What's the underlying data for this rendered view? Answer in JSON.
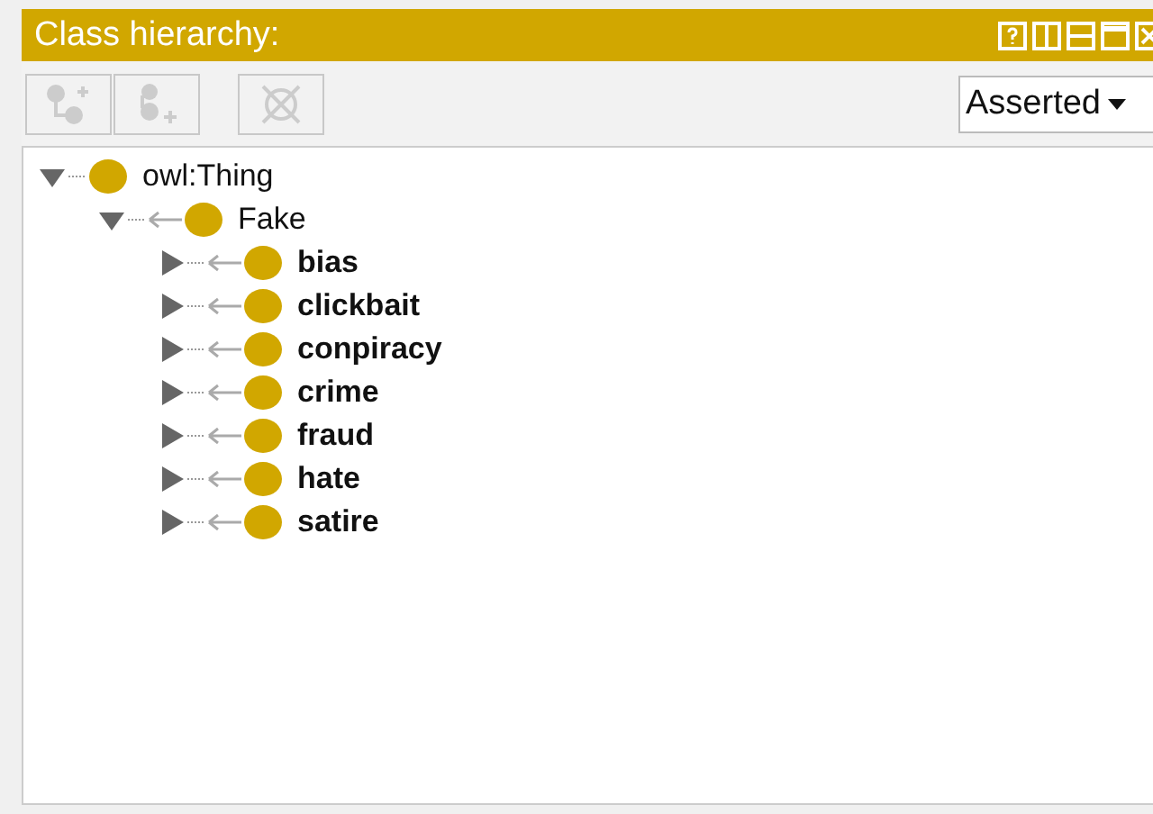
{
  "panel": {
    "title": "Class hierarchy:"
  },
  "toolbar": {
    "buttons": [
      {
        "kind": "add-subclass",
        "disabled": true
      },
      {
        "kind": "add-sibling",
        "disabled": true
      },
      {
        "kind": "delete",
        "disabled": true
      }
    ],
    "view_select": {
      "value": "Asserted"
    }
  },
  "tree": [
    {
      "label": "owl:Thing",
      "expanded": true,
      "bold": false,
      "children": [
        {
          "label": "Fake",
          "expanded": true,
          "bold": false,
          "children": [
            {
              "label": "bias",
              "expanded": false,
              "bold": true
            },
            {
              "label": "clickbait",
              "expanded": false,
              "bold": true
            },
            {
              "label": "conpiracy",
              "expanded": false,
              "bold": true
            },
            {
              "label": "crime",
              "expanded": false,
              "bold": true
            },
            {
              "label": "fraud",
              "expanded": false,
              "bold": true
            },
            {
              "label": "hate",
              "expanded": false,
              "bold": true
            },
            {
              "label": "satire",
              "expanded": false,
              "bold": true
            }
          ]
        }
      ]
    }
  ]
}
